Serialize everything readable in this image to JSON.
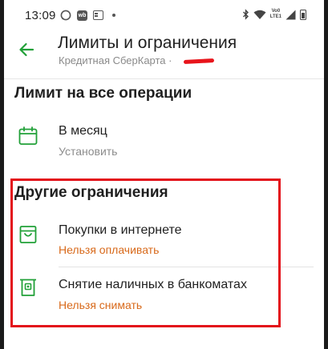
{
  "status_bar": {
    "time": "13:09",
    "notification_icons": [
      "whatsapp-icon",
      "wb-icon",
      "news-icon"
    ],
    "system_icons": [
      "bluetooth-icon",
      "wifi-icon",
      "volte-icon",
      "signal-icon",
      "battery-icon"
    ],
    "volte_line1": "Vo0",
    "volte_line2": "LTE1"
  },
  "header": {
    "title": "Лимиты и ограничения",
    "subtitle": "Кредитная СберКарта ·"
  },
  "section_all_ops": {
    "title": "Лимит на все операции",
    "items": [
      {
        "icon": "calendar-icon",
        "label": "В месяц",
        "status": "Установить"
      }
    ]
  },
  "section_other": {
    "title": "Другие ограничения",
    "items": [
      {
        "icon": "shopping-bag-icon",
        "label": "Покупки в интернете",
        "status": "Нельзя оплачивать"
      },
      {
        "icon": "atm-icon",
        "label": "Снятие наличных в банкоматах",
        "status": "Нельзя снимать"
      }
    ]
  },
  "colors": {
    "accent_green": "#21a038",
    "status_orange": "#d8691a",
    "highlight_red": "#e3111a"
  }
}
